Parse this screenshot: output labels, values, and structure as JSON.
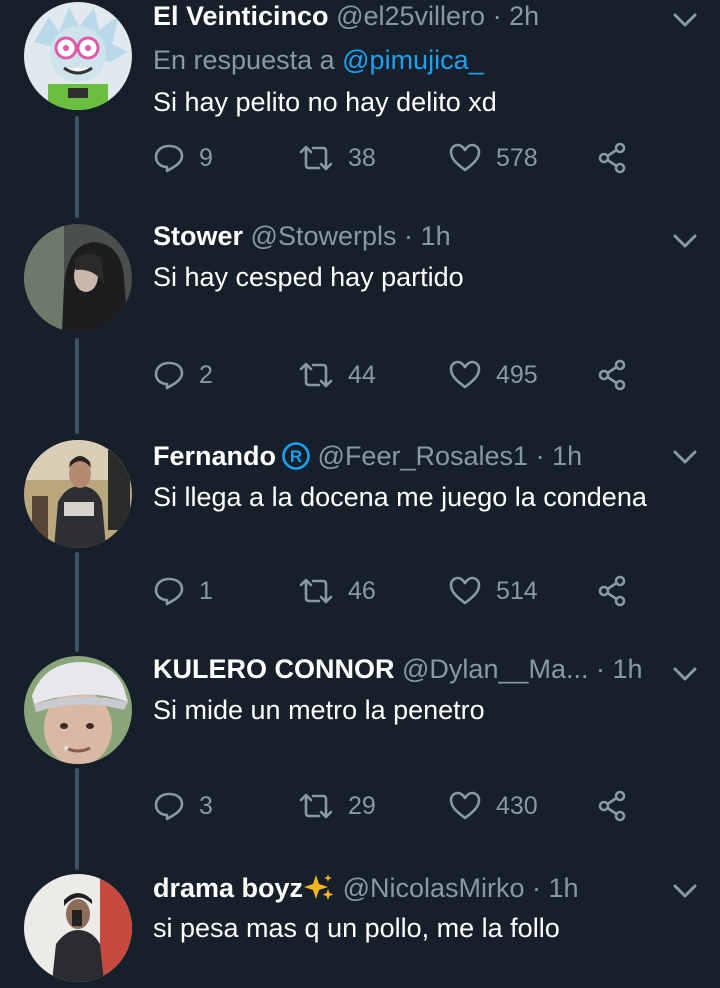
{
  "tweets": [
    {
      "name": "El Veinticinco",
      "handle": "@el25villero",
      "time": "2h",
      "reply_prefix": "En respuesta a",
      "reply_mention": "@pimujica_",
      "text": "Si hay pelito no hay delito xd",
      "replies": "9",
      "retweets": "38",
      "likes": "578"
    },
    {
      "name": "Stower",
      "handle": "@Stowerpls",
      "time": "1h",
      "text": "Si hay cesped hay partido",
      "replies": "2",
      "retweets": "44",
      "likes": "495"
    },
    {
      "name": "Fernando",
      "handle": "@Feer_Rosales1",
      "time": "1h",
      "text": "Si llega a la docena me juego la condena",
      "replies": "1",
      "retweets": "46",
      "likes": "514"
    },
    {
      "name": "KULERO CONNOR",
      "handle": "@Dylan__Ma...",
      "time": "1h",
      "text": "Si mide un metro la penetro",
      "replies": "3",
      "retweets": "29",
      "likes": "430"
    },
    {
      "name": "drama boyz",
      "handle": "@NicolasMirko",
      "time": "1h",
      "text": "si pesa mas q un pollo, me la follo"
    }
  ],
  "separator": "·",
  "colors": {
    "background": "#15202b",
    "text": "#ffffff",
    "secondary": "#8899a6",
    "accent": "#1da1f2",
    "thread_line": "#3d5466"
  },
  "icons": {
    "reply": "reply-icon",
    "retweet": "retweet-icon",
    "like": "heart-icon",
    "share": "share-icon",
    "menu": "chevron-down-icon",
    "verified": "registered-badge-icon",
    "sparkle": "sparkle-icon"
  }
}
